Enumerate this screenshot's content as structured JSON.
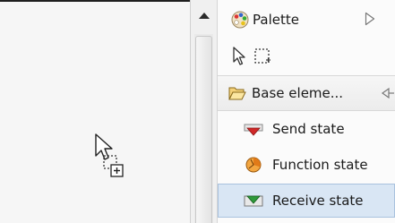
{
  "palette": {
    "title": "Palette",
    "tools": [
      {
        "name": "select-tool",
        "icon": "arrow-select-icon"
      },
      {
        "name": "marquee-tool",
        "icon": "marquee-icon"
      }
    ],
    "drawer": {
      "label": "Base eleme...",
      "icon": "folder-open-icon"
    },
    "entries": [
      {
        "label": "Send state",
        "icon": "send-state-icon"
      },
      {
        "label": "Function state",
        "icon": "function-state-icon"
      },
      {
        "label": "Receive state",
        "icon": "receive-state-icon",
        "selected": true
      }
    ]
  },
  "colors": {
    "selection_bg": "#d9e6f4",
    "canvas_bg": "#f6f6f6",
    "send_red": "#d02828",
    "function_orange": "#e07a18",
    "receive_green": "#2e9a3a"
  }
}
